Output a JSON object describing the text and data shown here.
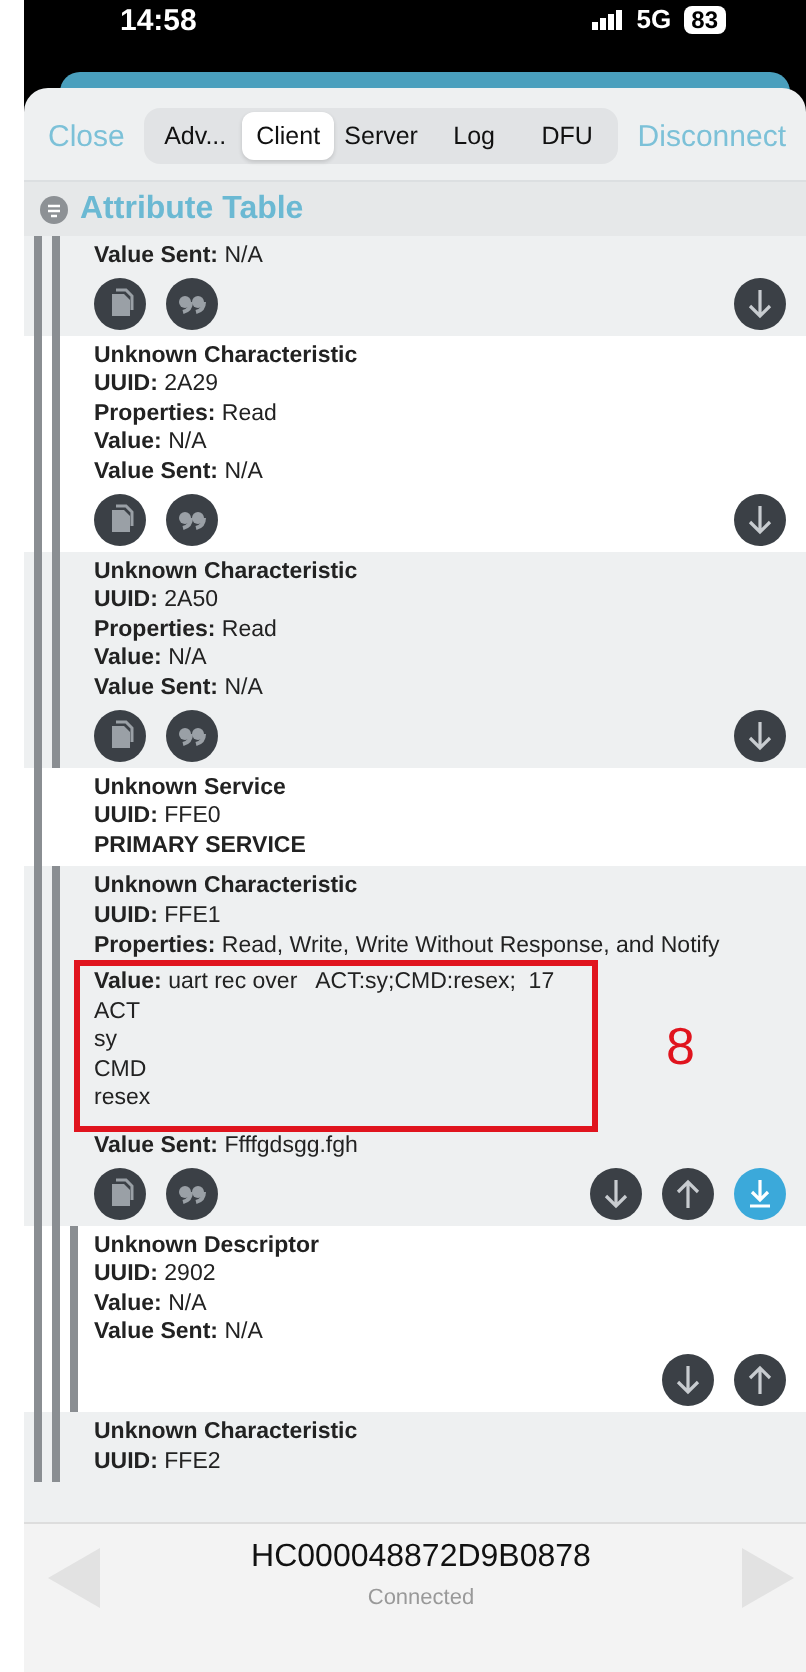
{
  "status_bar": {
    "time": "14:58",
    "network": "5G",
    "battery": "83"
  },
  "toolbar": {
    "close": "Close",
    "disconnect": "Disconnect",
    "tabs": [
      {
        "label": "Adv...",
        "selected": false
      },
      {
        "label": "Client",
        "selected": true
      },
      {
        "label": "Server",
        "selected": false
      },
      {
        "label": "Log",
        "selected": false
      },
      {
        "label": "DFU",
        "selected": false
      }
    ]
  },
  "section": {
    "title": "Attribute Table"
  },
  "attributes": [
    {
      "kind": "characteristic",
      "fields": [
        {
          "label": "Value Sent:",
          "value": "N/A"
        }
      ],
      "actions": [
        {
          "kind": "copy",
          "on": false
        },
        {
          "kind": "quote",
          "on": false
        },
        {
          "kind": "read",
          "on": false
        }
      ]
    },
    {
      "kind": "characteristic",
      "title": "Unknown Characteristic",
      "fields": [
        {
          "label": "UUID:",
          "value": "2A29"
        },
        {
          "label": "Properties:",
          "value": "Read"
        },
        {
          "label": "Value:",
          "value": "N/A"
        },
        {
          "label": "Value Sent:",
          "value": "N/A"
        }
      ],
      "actions": [
        {
          "kind": "copy",
          "on": false
        },
        {
          "kind": "quote",
          "on": false
        },
        {
          "kind": "read",
          "on": false
        }
      ]
    },
    {
      "kind": "characteristic",
      "title": "Unknown Characteristic",
      "fields": [
        {
          "label": "UUID:",
          "value": "2A50"
        },
        {
          "label": "Properties:",
          "value": "Read"
        },
        {
          "label": "Value:",
          "value": "N/A"
        },
        {
          "label": "Value Sent:",
          "value": "N/A"
        }
      ],
      "actions": [
        {
          "kind": "copy",
          "on": false
        },
        {
          "kind": "quote",
          "on": false
        },
        {
          "kind": "read",
          "on": false
        }
      ]
    },
    {
      "kind": "service",
      "title": "Unknown Service",
      "fields": [
        {
          "label": "UUID:",
          "value": "FFE0"
        }
      ],
      "footer": "PRIMARY SERVICE"
    },
    {
      "kind": "characteristic",
      "title": "Unknown Characteristic",
      "fields": [
        {
          "label": "UUID:",
          "value": "FFE1"
        },
        {
          "label": "Properties:",
          "value": "Read, Write, Write Without Response, and Notify"
        },
        {
          "label": "Value:",
          "value": "uart rec over   ACT:sy;CMD:resex;  17",
          "lines": [
            "ACT",
            "sy",
            "CMD",
            "resex"
          ],
          "annotation": "8"
        },
        {
          "label": "Value Sent:",
          "value": "Ffffgdsgg.fgh"
        }
      ],
      "actions": [
        {
          "kind": "copy",
          "on": false
        },
        {
          "kind": "quote",
          "on": false
        },
        {
          "kind": "read",
          "on": false
        },
        {
          "kind": "write",
          "on": false
        },
        {
          "kind": "notify",
          "on": true
        }
      ]
    },
    {
      "kind": "descriptor",
      "title": "Unknown Descriptor",
      "fields": [
        {
          "label": "UUID:",
          "value": "2902"
        },
        {
          "label": "Value:",
          "value": "N/A"
        },
        {
          "label": "Value Sent:",
          "value": "N/A"
        }
      ],
      "actions": [
        {
          "kind": "read",
          "on": false
        },
        {
          "kind": "write",
          "on": false
        }
      ]
    },
    {
      "kind": "characteristic",
      "title": "Unknown Characteristic",
      "fields": [
        {
          "label": "UUID:",
          "value": "FFE2"
        }
      ]
    }
  ],
  "device_bar": {
    "name": "HC000048872D9B0878",
    "status": "Connected"
  }
}
